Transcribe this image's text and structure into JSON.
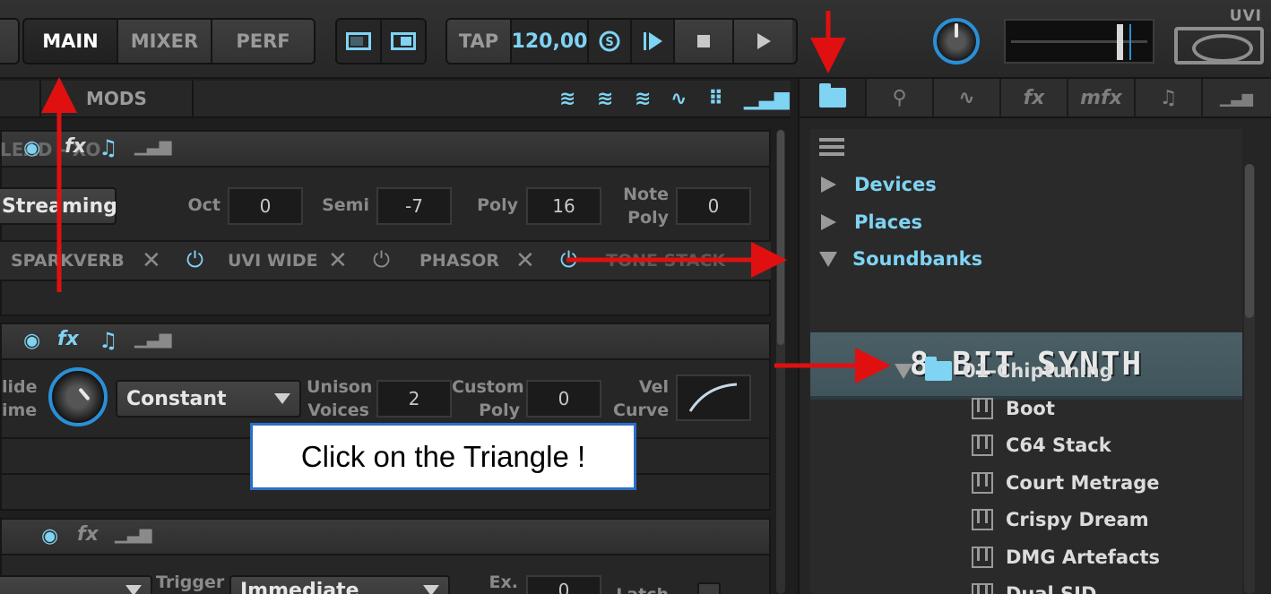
{
  "topbar": {
    "tabs": [
      {
        "label": "MAIN",
        "active": true
      },
      {
        "label": "MIXER",
        "active": false
      },
      {
        "label": "PERF",
        "active": false
      }
    ],
    "transport": {
      "tap": "TAP",
      "tempo": "120,00"
    },
    "logo": "UVI"
  },
  "left": {
    "mods_tab": "MODS",
    "layer1": {
      "title_fragment": "LEAD - XO",
      "streaming": "Streaming",
      "oct_label": "Oct",
      "oct": "0",
      "semi_label": "Semi",
      "semi": "-7",
      "poly_label": "Poly",
      "poly": "16",
      "note_poly_label_1": "Note",
      "note_poly_label_2": "Poly",
      "note_poly": "0"
    },
    "fx_chain": [
      "SPARKVERB",
      "UVI WIDE",
      "PHASOR",
      "TONE STACK"
    ],
    "layer2": {
      "glide_label_1": "lide",
      "glide_label_2": "ime",
      "mode": "Constant",
      "unison_label_1": "Unison",
      "unison_label_2": "Voices",
      "unison": "2",
      "custom_label_1": "Custom",
      "custom_label_2": "Poly",
      "custom": "0",
      "vel_label_1": "Vel",
      "vel_label_2": "Curve"
    },
    "layer3": {
      "trigger_label": "Trigger",
      "trigger": "Immediate",
      "ex_label": "Ex.",
      "ex": "0",
      "latch_label": "Latch"
    }
  },
  "browser": {
    "tree": [
      {
        "label": "Devices",
        "expanded": false
      },
      {
        "label": "Places",
        "expanded": false
      },
      {
        "label": "Soundbanks",
        "expanded": true
      }
    ],
    "banner": "8-BIT SYNTH",
    "folder": "01-Chiptuning",
    "presets": [
      "Boot",
      "C64 Stack",
      "Court Metrage",
      "Crispy Dream",
      "DMG Artefacts",
      "Dual SID"
    ]
  },
  "callout": "Click on the Triangle !",
  "colors": {
    "accent": "#7fd3f3",
    "arrow": "#e01010",
    "callout_border": "#2a70c6"
  }
}
